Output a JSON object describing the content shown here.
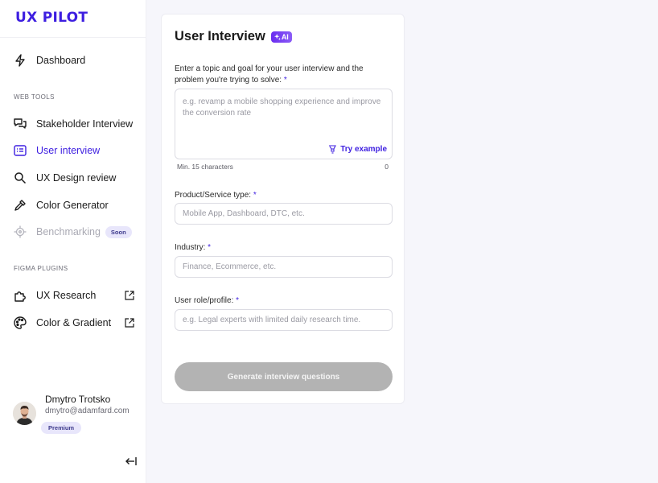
{
  "brand": {
    "logo_text": "UX PILOT",
    "accent": "#3d1ee0"
  },
  "sidebar": {
    "dashboard": {
      "label": "Dashboard",
      "icon": "lightning-icon"
    },
    "web_tools_label": "WEB TOOLS",
    "web_tools": [
      {
        "label": "Stakeholder Interview",
        "icon": "chat-bubbles-icon",
        "active": false
      },
      {
        "label": "User interview",
        "icon": "list-card-icon",
        "active": true
      },
      {
        "label": "UX Design review",
        "icon": "magnifier-icon",
        "active": false
      },
      {
        "label": "Color Generator",
        "icon": "eyedropper-icon",
        "active": false
      },
      {
        "label": "Benchmarking",
        "icon": "target-icon",
        "active": false,
        "badge": "Soon"
      }
    ],
    "figma_plugins_label": "FIGMA PLUGINS",
    "figma_plugins": [
      {
        "label": "UX Research",
        "icon": "puzzle-icon",
        "external_icon": "external-link-icon"
      },
      {
        "label": "Color & Gradient",
        "icon": "palette-icon",
        "external_icon": "external-link-icon"
      }
    ],
    "user": {
      "name": "Dmytro Trotsko",
      "email": "dmytro@adamfard.com",
      "plan": "Premium"
    },
    "collapse_icon": "collapse-left-icon"
  },
  "form": {
    "title": "User Interview",
    "ai_badge": "AI",
    "topic": {
      "label": "Enter a topic and goal for your user interview and the problem you're trying to solve:",
      "required_mark": "*",
      "placeholder": "e.g. revamp a mobile shopping experience and improve the conversion rate",
      "try_example": "Try example",
      "min_chars": "Min. 15 characters",
      "char_count": "0"
    },
    "product": {
      "label": "Product/Service type:",
      "required_mark": "*",
      "placeholder": "Mobile App, Dashboard, DTC, etc."
    },
    "industry": {
      "label": "Industry:",
      "required_mark": "*",
      "placeholder": "Finance, Ecommerce, etc."
    },
    "role": {
      "label": "User role/profile:",
      "required_mark": "*",
      "placeholder": "e.g. Legal experts with limited daily research time."
    },
    "generate_button": "Generate interview questions"
  }
}
